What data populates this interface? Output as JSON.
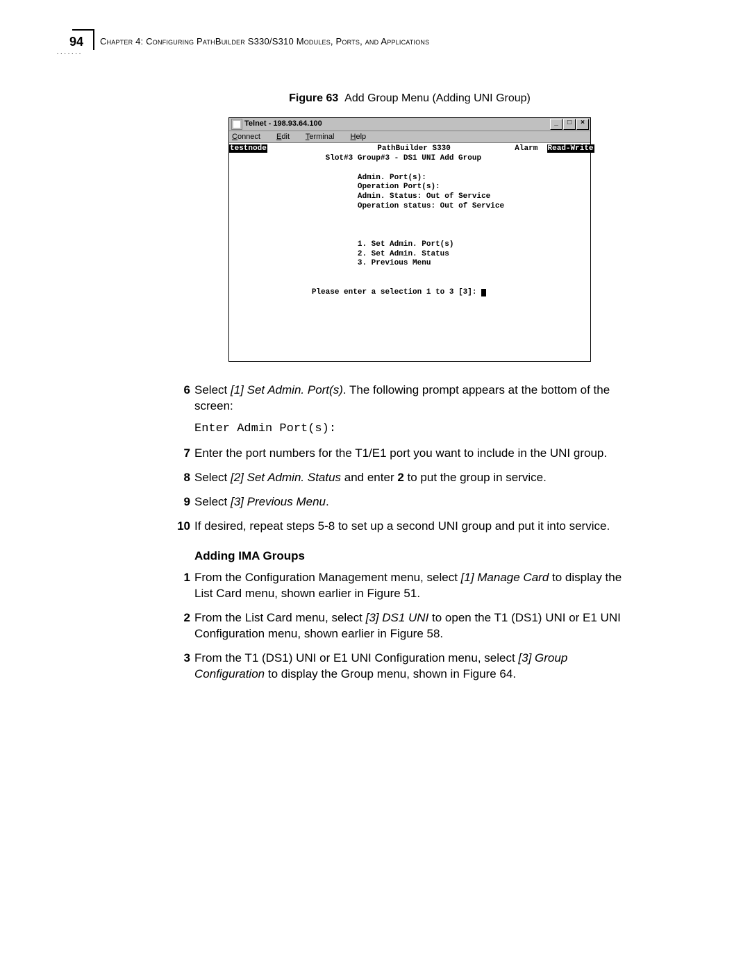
{
  "page_number": "94",
  "chapter_header": "Chapter 4: Configuring PathBuilder S330/S310 Modules, Ports, and Applications",
  "figure_label": "Figure 63",
  "figure_caption": "Add Group Menu (Adding UNI Group)",
  "telnet": {
    "title": "Telnet - 198.93.64.100",
    "menus": {
      "connect": "onnect",
      "edit": "dit",
      "terminal": "erminal",
      "help": "elp",
      "connect_u": "C",
      "edit_u": "E",
      "terminal_u": "T",
      "help_u": "H"
    },
    "sys": {
      "min": "_",
      "max": "□",
      "close": "×"
    },
    "hostname": "testnode",
    "hdr_center": "PathBuilder S330",
    "hdr_alarm": "Alarm",
    "hdr_mode": "Read-Write",
    "subhdr": "Slot#3 Group#3 - DS1 UNI Add Group",
    "l1": "Admin. Port(s):",
    "l2": "Operation Port(s):",
    "l3": "Admin. Status: Out of Service",
    "l4": "Operation status: Out of Service",
    "m1": "1. Set Admin. Port(s)",
    "m2": "2. Set Admin. Status",
    "m3": "3. Previous Menu",
    "prompt": "Please enter a selection 1 to 3 [3]: "
  },
  "steps_a": {
    "s6_a": "Select ",
    "s6_it": "[1] Set Admin. Port(s)",
    "s6_b": ". The following prompt appears at the bottom of the screen:",
    "s6_code": "Enter Admin Port(s):",
    "s7": "Enter the port numbers for the T1/E1 port you want to include in the UNI group.",
    "s8_a": "Select ",
    "s8_it": "[2] Set Admin. Status",
    "s8_b": " and enter ",
    "s8_bold": "2",
    "s8_c": " to put the group in service.",
    "s9_a": "Select ",
    "s9_it": "[3] Previous Menu",
    "s9_b": ".",
    "s10": "If desired, repeat steps 5-8 to set up a second UNI group and put it into service."
  },
  "subhead": "Adding IMA Groups",
  "steps_b": {
    "s1_a": "From the Configuration Management menu, select ",
    "s1_it": "[1] Manage Card",
    "s1_b": " to display the List Card menu, shown earlier in Figure 51.",
    "s2_a": "From the List Card menu, select ",
    "s2_it": "[3] DS1 UNI",
    "s2_b": " to open the T1 (DS1) UNI or E1 UNI Configuration menu, shown earlier in Figure 58.",
    "s3_a": "From the T1 (DS1) UNI or E1 UNI Configuration menu, select ",
    "s3_it": "[3] Group Configuration",
    "s3_b": " to display the Group menu, shown in Figure 64."
  },
  "nums": {
    "n6": "6",
    "n7": "7",
    "n8": "8",
    "n9": "9",
    "n10": "10",
    "n1": "1",
    "n2": "2",
    "n3": "3"
  }
}
